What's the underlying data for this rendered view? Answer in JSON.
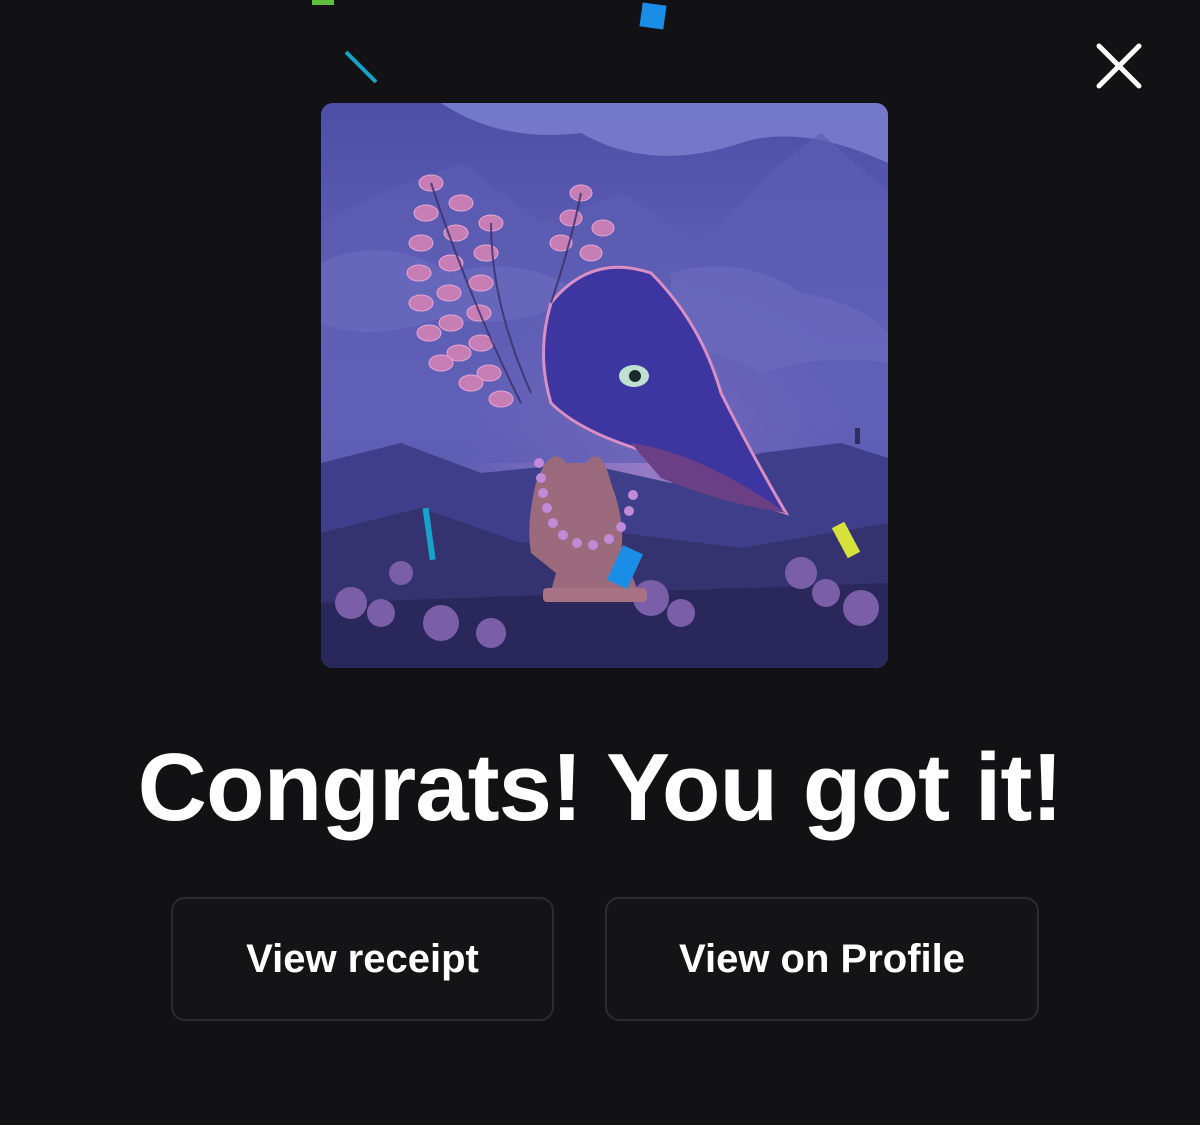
{
  "headline": "Congrats! You got it!",
  "buttons": {
    "view_receipt": "View receipt",
    "view_on_profile": "View on Profile"
  },
  "icons": {
    "close": "close-icon"
  },
  "colors": {
    "background": "#121214",
    "button_border": "#2b2b30",
    "text": "#ffffff",
    "art_sky": "#5a5ab0",
    "art_accent_pink": "#d98fc4"
  }
}
